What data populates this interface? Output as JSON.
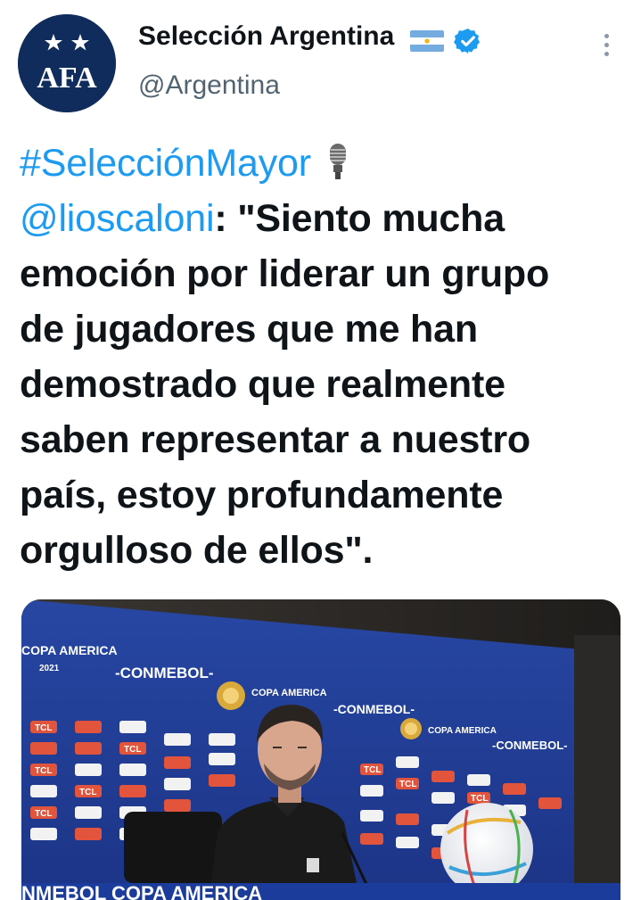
{
  "tweet": {
    "author": {
      "display_name": "Selección Argentina",
      "handle": "@Argentina",
      "avatar_icon": "afa-logo-icon",
      "avatar_text": "AFA",
      "flag_icon": "argentina-flag-icon",
      "verified_icon": "verified-badge-icon"
    },
    "more_icon": "more-options-icon",
    "text": {
      "hashtag": "#SelecciónMayor",
      "mention": "@lioscaloni",
      "lines": [
        ": \"Siento mucha",
        "emoción por liderar un grupo",
        "de jugadores que me han",
        "demostrado que realmente",
        "saben representar a nuestro",
        "país, estoy profundamente",
        "orgulloso de ellos\"."
      ]
    },
    "media": {
      "backdrop_labels": {
        "conmebol": "-CONMEBOL-",
        "copa_america": "COPA AMERICA",
        "year": "2021",
        "sponsor": "TCL",
        "bottom_banner": "NMEBOL COPA AMERICA"
      }
    }
  },
  "colors": {
    "text": "#0f1419",
    "secondary": "#536471",
    "link": "#1d9bf0",
    "verified": "#1d9bf0",
    "avatar_bg": "#0f2c5c",
    "backdrop_blue": "#1e3a8f"
  }
}
